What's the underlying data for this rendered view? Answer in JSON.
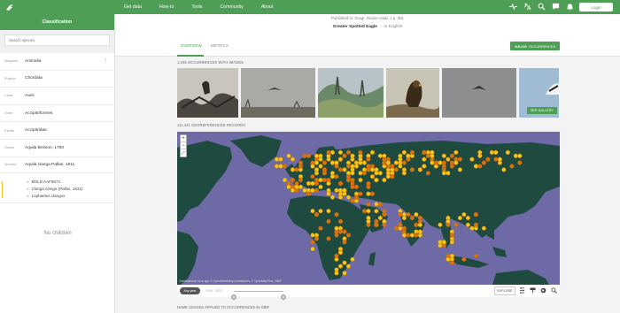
{
  "navbar": {
    "logo_icon": "gbif-bird-logo-icon",
    "menu": [
      "Get data",
      "How-to",
      "Tools",
      "Community",
      "About"
    ],
    "icons": [
      "activity-icon",
      "translate-icon",
      "search-icon",
      "feedback-icon",
      "notifications-icon"
    ],
    "login_label": "Login"
  },
  "sidebar": {
    "header": "Classification",
    "search_placeholder": "Search species",
    "ranks": [
      {
        "key": "Kingdom",
        "value": "Animalia"
      },
      {
        "key": "Phylum",
        "value": "Chordata"
      },
      {
        "key": "Class",
        "value": "Aves"
      },
      {
        "key": "Order",
        "value": "Accipitriformes"
      },
      {
        "key": "Family",
        "value": "Accipitridae"
      },
      {
        "key": "Genus",
        "value": "Aquila Brisson, 1760"
      }
    ],
    "species": {
      "key": "Species",
      "value": "Aquila clanga Pallas, 1811"
    },
    "names": [
      "BOLD:AAF5873",
      "Clanga clanga (Pallas, 1811)",
      "Lophaetus clangus"
    ],
    "no_children": "No children"
  },
  "header": {
    "published": "Published in: Zoogr. Rosso-Asiat. 1 p. 351",
    "common_name": "Greater Spotted Eagle",
    "language": "In English"
  },
  "tabs": {
    "overview": "OVERVIEW",
    "metrics": "METRICS",
    "occurrences_count": "119,229",
    "occurrences_label": "OCCURRENCES"
  },
  "gallery": {
    "label": "1,046 OCCURRENCES WITH IMAGES",
    "see_gallery": "SEE GALLERY"
  },
  "map": {
    "label": "111,441 GEOREFERENCED RECORDS",
    "attribution": "Generated an hour ago © OpenStreetMap contributors, © OpenMapTiles, GBIF.",
    "year_chip": "Any year",
    "year_range": "1900 - 2021",
    "explore_label": "EXPLORE",
    "tools": [
      "filter-icon",
      "brush-icon",
      "globe-icon",
      "zoom-extent-icon"
    ],
    "colors": {
      "ocean": "#6e6aa5",
      "land": "#1e4a3f",
      "hex_low": "#f5c518",
      "hex_high": "#d87410"
    }
  },
  "footer": {
    "label": "NAME USAGES APPLIED TO OCCURRENCES IN GBIF"
  }
}
